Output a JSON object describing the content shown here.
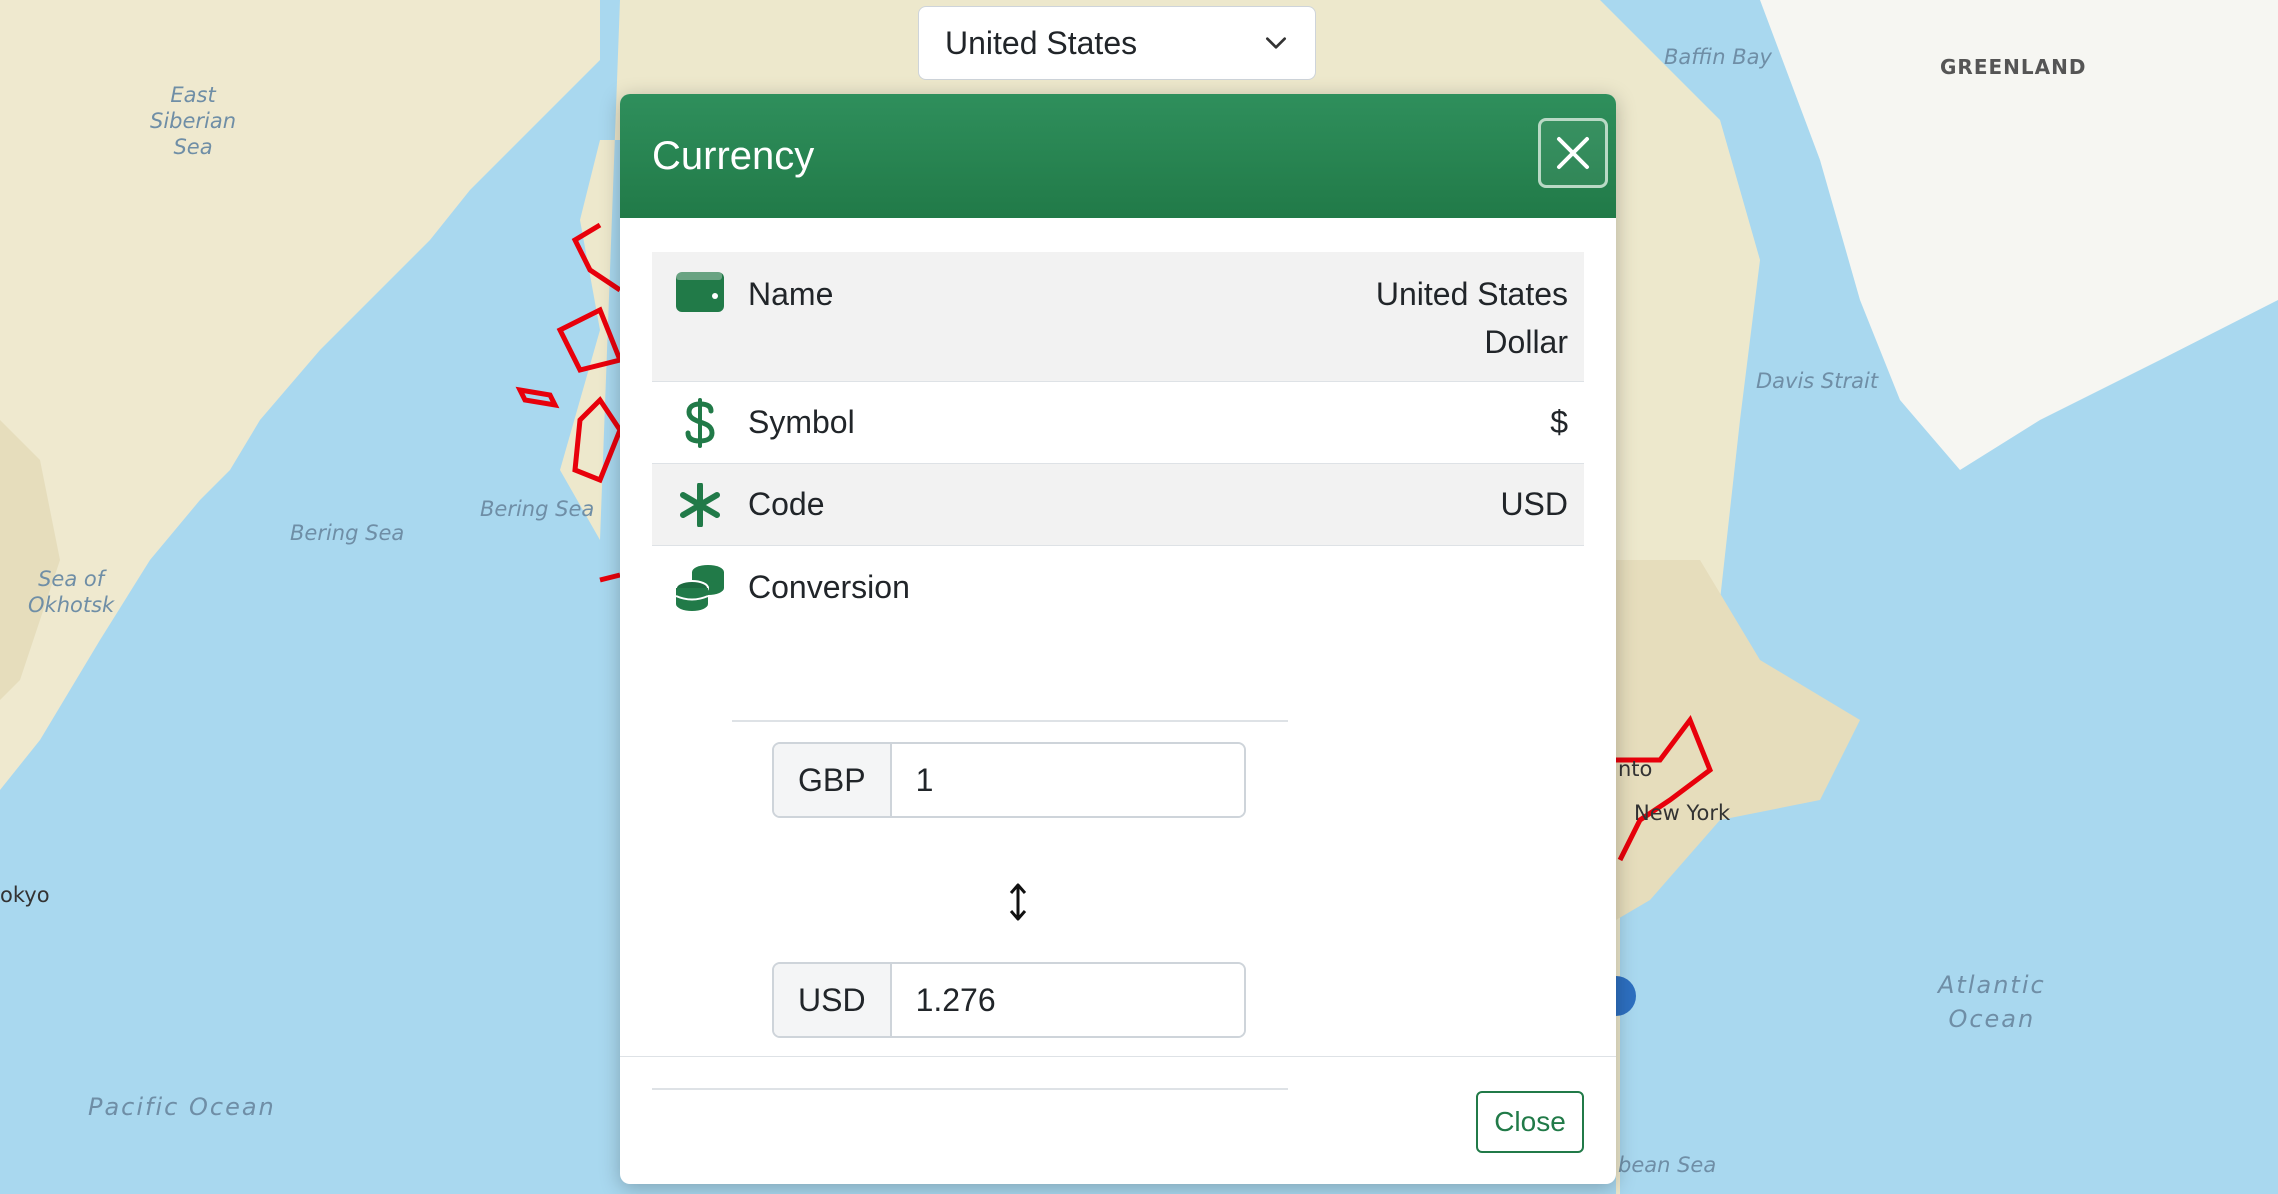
{
  "map": {
    "labels": {
      "east_siberian_sea": "East\nSiberian\nSea",
      "bering_sea_1": "Bering Sea",
      "bering_sea_2": "Bering Sea",
      "sea_of_okhotsk": "Sea of\nOkhotsk",
      "pacific_ocean": "Pacific Ocean",
      "baffin_bay": "Baffin Bay",
      "greenland": "GREENLAND",
      "davis_strait": "Davis Strait",
      "atlantic_ocean": "Atlantic\nOcean",
      "tokyo": "okyo",
      "new_york": "New York",
      "toronto": "nto",
      "caribbean_sea": "bean Sea"
    },
    "highlight_color": "#e8000b"
  },
  "country_select": {
    "selected": "United States"
  },
  "modal": {
    "title": "Currency",
    "rows": {
      "name": {
        "label": "Name",
        "value": "United States Dollar",
        "icon": "wallet-icon"
      },
      "symbol": {
        "label": "Symbol",
        "value": "$",
        "icon": "dollar-icon"
      },
      "code": {
        "label": "Code",
        "value": "USD",
        "icon": "asterisk-icon"
      },
      "conversion": {
        "label": "Conversion",
        "icon": "coins-icon"
      }
    },
    "conversion": {
      "from_code": "GBP",
      "from_value": "1",
      "to_code": "USD",
      "to_value": "1.276"
    },
    "close_label": "Close"
  },
  "colors": {
    "accent": "#217a48",
    "header": "#2f8f5c"
  }
}
